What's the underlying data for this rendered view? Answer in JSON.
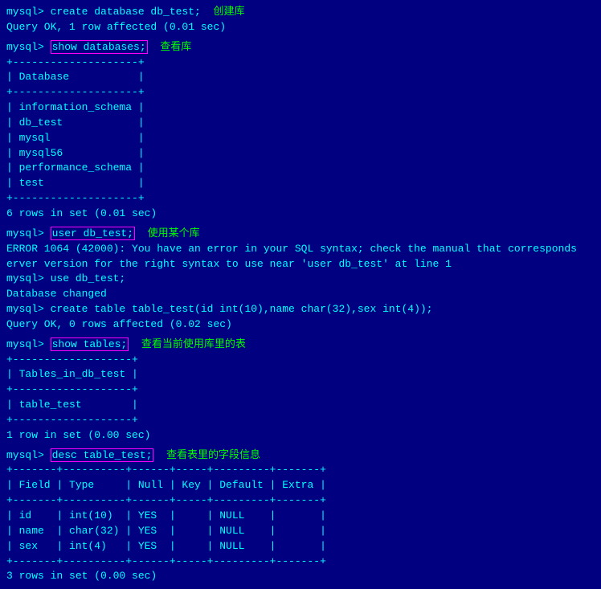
{
  "terminal": {
    "lines": [
      {
        "id": "l1",
        "type": "prompt-cmd",
        "prompt": "mysql> ",
        "cmd": "create database db_test;",
        "annotation": "创建库",
        "annotationColor": "#00FF00"
      },
      {
        "id": "l2",
        "type": "output",
        "text": "Query OK, 1 row affected (0.01 sec)"
      },
      {
        "id": "l3",
        "type": "blank"
      },
      {
        "id": "l4",
        "type": "prompt-cmd-box",
        "prompt": "mysql> ",
        "cmd": "show databases;",
        "annotation": "查看库",
        "annotationColor": "#00FF00"
      },
      {
        "id": "l5",
        "type": "table-top"
      },
      {
        "id": "l6",
        "type": "table-header",
        "col": " Database           "
      },
      {
        "id": "l7",
        "type": "table-sep"
      },
      {
        "id": "l8",
        "type": "table-row",
        "col": " information_schema "
      },
      {
        "id": "l9",
        "type": "table-row",
        "col": " db_test            "
      },
      {
        "id": "l10",
        "type": "table-row",
        "col": " mysql              "
      },
      {
        "id": "l11",
        "type": "table-row",
        "col": " mysql56            "
      },
      {
        "id": "l12",
        "type": "table-row",
        "col": " performance_schema "
      },
      {
        "id": "l13",
        "type": "table-row",
        "col": " test               "
      },
      {
        "id": "l14",
        "type": "table-bottom"
      },
      {
        "id": "l15",
        "type": "output",
        "text": "6 rows in set (0.01 sec)"
      },
      {
        "id": "l16",
        "type": "blank"
      },
      {
        "id": "l17",
        "type": "prompt-cmd-box",
        "prompt": "mysql> ",
        "cmd": "user db_test;",
        "annotation": "使用某个库",
        "annotationColor": "#00FF00"
      },
      {
        "id": "l18",
        "type": "output",
        "text": "ERROR 1064 (42000): You have an error in your SQL syntax; check the manual that corresponds"
      },
      {
        "id": "l19",
        "type": "output",
        "text": "erver version for the right syntax to use near 'user db_test' at line 1"
      },
      {
        "id": "l20",
        "type": "prompt-cmd",
        "prompt": "mysql> ",
        "cmd": "use db_test;"
      },
      {
        "id": "l21",
        "type": "output",
        "text": "Database changed"
      },
      {
        "id": "l22",
        "type": "output",
        "text": "mysql> create table table_test(id int(10),name char(32),sex int(4));"
      },
      {
        "id": "l23",
        "type": "output",
        "text": "Query OK, 0 rows affected (0.02 sec)"
      },
      {
        "id": "l24",
        "type": "blank"
      },
      {
        "id": "l25",
        "type": "prompt-cmd-box",
        "prompt": "mysql> ",
        "cmd": "show tables;",
        "annotation": "查看当前使用库里的表",
        "annotationColor": "#00FF00"
      },
      {
        "id": "l26",
        "type": "table-top"
      },
      {
        "id": "l27",
        "type": "table-header",
        "col": " Tables_in_db_test "
      },
      {
        "id": "l28",
        "type": "table-sep"
      },
      {
        "id": "l29",
        "type": "table-row",
        "col": " table_test        "
      },
      {
        "id": "l30",
        "type": "table-bottom"
      },
      {
        "id": "l31",
        "type": "output",
        "text": "1 row in set (0.00 sec)"
      },
      {
        "id": "l32",
        "type": "blank"
      },
      {
        "id": "l33",
        "type": "prompt-cmd-box",
        "prompt": "mysql> ",
        "cmd": "desc table_test;",
        "annotation": "查看表里的字段信息",
        "annotationColor": "#00FF00"
      },
      {
        "id": "l34",
        "type": "table-top-wide"
      },
      {
        "id": "l35",
        "type": "table-header-wide",
        "cols": [
          " Field ",
          " Type     ",
          " Null ",
          " Key ",
          " Default ",
          " Extra "
        ]
      },
      {
        "id": "l36",
        "type": "table-sep-wide"
      },
      {
        "id": "l37",
        "type": "table-row-wide",
        "cols": [
          " id   ",
          " int(10)  ",
          " YES  ",
          "     ",
          " NULL    ",
          "       "
        ]
      },
      {
        "id": "l38",
        "type": "table-row-wide",
        "cols": [
          " name ",
          " char(32) ",
          " YES  ",
          "     ",
          " NULL    ",
          "       "
        ]
      },
      {
        "id": "l39",
        "type": "table-row-wide",
        "cols": [
          " sex  ",
          " int(4)   ",
          " YES  ",
          "     ",
          " NULL    ",
          "       "
        ]
      },
      {
        "id": "l40",
        "type": "table-bottom-wide"
      },
      {
        "id": "l41",
        "type": "output",
        "text": "3 rows in set (0.00 sec)"
      }
    ]
  }
}
